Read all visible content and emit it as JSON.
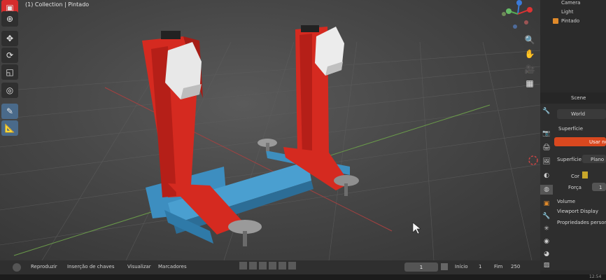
{
  "viewport": {
    "header_text": "(1) Collection | Pintado"
  },
  "toolbar": {
    "tools": [
      "select-box-icon",
      "cursor-icon",
      "move-icon",
      "rotate-icon",
      "scale-icon",
      "transform-icon",
      "annotate-icon",
      "measure-icon"
    ]
  },
  "gizmo": {
    "x_label": "X",
    "y_label": "Y",
    "z_label": "Z"
  },
  "outliner": {
    "items": [
      "Camera",
      "Light",
      "Pintado"
    ]
  },
  "properties": {
    "tab_scene": "Scene",
    "world_name": "World",
    "panel_surface": "Superfície",
    "use_nodes_button": "Usar nó",
    "surface_label": "Superfície",
    "surface_value": "Plano",
    "color_label": "Cor",
    "strength_label": "Força",
    "strength_value": "1",
    "volume_label": "Volume",
    "viewport_display_label": "Viewport Display",
    "custom_props_label": "Propriedades personalizadas"
  },
  "timeline": {
    "menu_playback": "Reproduzir",
    "menu_keying": "Inserção de chaves",
    "menu_view": "Visualizar",
    "menu_markers": "Marcadores",
    "current_frame": "1",
    "start_label": "Início",
    "start_value": "1",
    "end_label": "Fim",
    "end_value": "250"
  },
  "statusbar": {
    "clock": "12:54"
  },
  "colors": {
    "accent_red": "#e03a2a",
    "model_red": "#d82b22",
    "model_blue": "#3e8fbf",
    "active_button": "#d9481f"
  }
}
